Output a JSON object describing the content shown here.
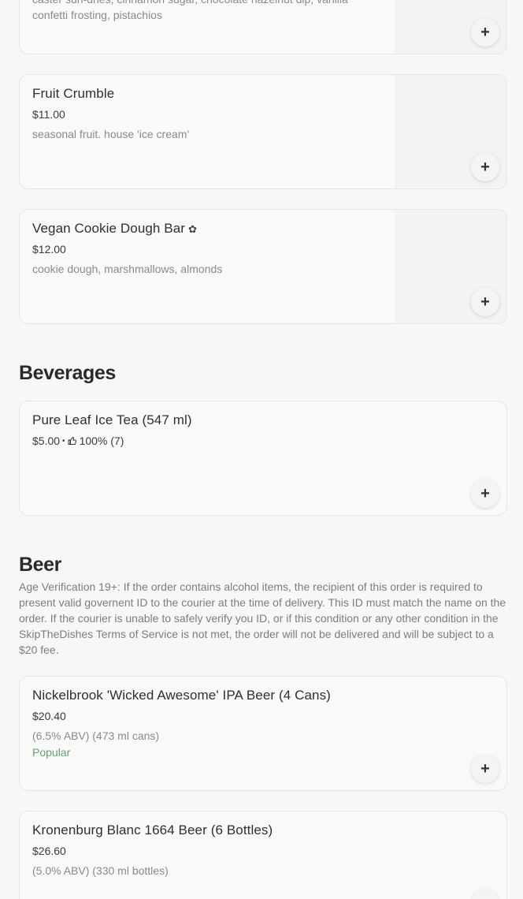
{
  "sections": {
    "dessert_items": [
      {
        "desc_line1": "caster sun-dries, cinnamon sugar, chocolate hazelnut dip, vanilla",
        "desc_line2": "confetti frosting, pistachios"
      },
      {
        "name": "Fruit Crumble",
        "price": "$11.00",
        "desc": "seasonal fruit. house 'ice cream'"
      },
      {
        "name": "Vegan Cookie Dough Bar",
        "name_icon": "leaf-icon",
        "price": "$12.00",
        "desc": "cookie dough, marshmallows, almonds"
      }
    ],
    "beverages": {
      "title": "Beverages",
      "items": [
        {
          "name": "Pure Leaf Ice Tea (547 ml)",
          "price": "$5.00",
          "separator": "•",
          "rating": "100% (7)",
          "rating_icon": "thumbs-up-icon"
        }
      ]
    },
    "beer": {
      "title": "Beer",
      "description": "Age Verification 19+: If the order contains alcohol items, the recipient of this order is required to present valid governent ID to the courier at the time of delivery. This ID must match the name on the order. If the courier is unable to safely verify you ID, or if this condition or any other condition in the SkipTheDishes Terms of Service is not met, the order will not be delivered and will be subject to a $20 fee.",
      "items": [
        {
          "name": "Nickelbrook 'Wicked Awesome' IPA Beer (4 Cans)",
          "price": "$20.40",
          "desc": "(6.5% ABV) (473 ml cans)",
          "badge": "Popular"
        },
        {
          "name": "Kronenburg Blanc 1664 Beer (6 Bottles)",
          "price": "$26.60",
          "desc": "(5.0% ABV) (330 ml bottles)"
        }
      ]
    }
  },
  "add_button_label": "+",
  "colors": {
    "popular": "#6b9e6f",
    "card_bg": "#f9f9f9",
    "border": "#e7e7e7"
  }
}
